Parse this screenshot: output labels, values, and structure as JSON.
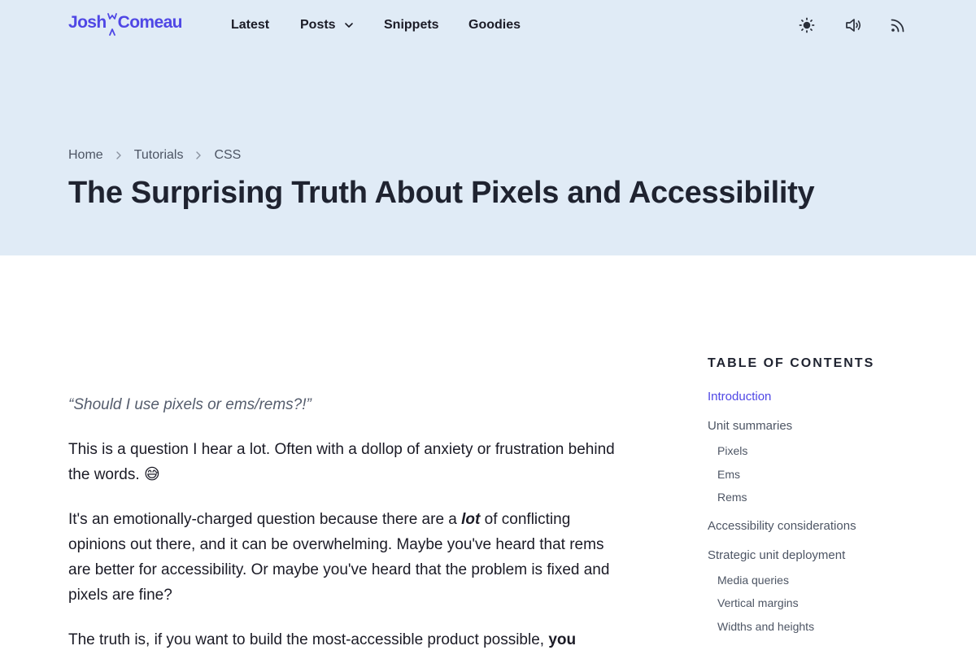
{
  "colors": {
    "accent": "#4f47e5",
    "hero_bg": "#e0ebf6",
    "text": "#1b1b26",
    "muted": "#4d5564"
  },
  "logo": {
    "first": "Josh",
    "last": "Comeau"
  },
  "nav": {
    "latest": "Latest",
    "posts": "Posts",
    "snippets": "Snippets",
    "goodies": "Goodies"
  },
  "icons": [
    "sun-icon",
    "speaker-icon",
    "rss-icon",
    "chevron-right-icon",
    "chevron-down-icon"
  ],
  "breadcrumb": {
    "home": "Home",
    "tutorials": "Tutorials",
    "css": "CSS"
  },
  "page_title": "The Surprising Truth About Pixels and Accessibility",
  "article": {
    "quote": "“Should I use pixels or ems/rems?!”",
    "p1_text": "This is a question I hear a lot. Often with a dollop of anxiety or frustration behind the words.",
    "p1_emoji": "😅",
    "p2_before": "It's an emotionally-charged question because there are a",
    "p2_em": "lot",
    "p2_after": "of conflicting opinions out there, and it can be overwhelming. Maybe you've heard that rems are better for accessibility. Or maybe you've heard that the problem is fixed and pixels are fine?",
    "p3_before": "The truth is, if you want to build the most-accessible product possible,",
    "p3_strong": "you"
  },
  "toc": {
    "heading": "TABLE OF CONTENTS",
    "introduction": "Introduction",
    "unit_summaries": "Unit summaries",
    "pixels": "Pixels",
    "ems": "Ems",
    "rems": "Rems",
    "accessibility": "Accessibility considerations",
    "strategic": "Strategic unit deployment",
    "media_queries": "Media queries",
    "vertical_margins": "Vertical margins",
    "widths_heights": "Widths and heights"
  }
}
